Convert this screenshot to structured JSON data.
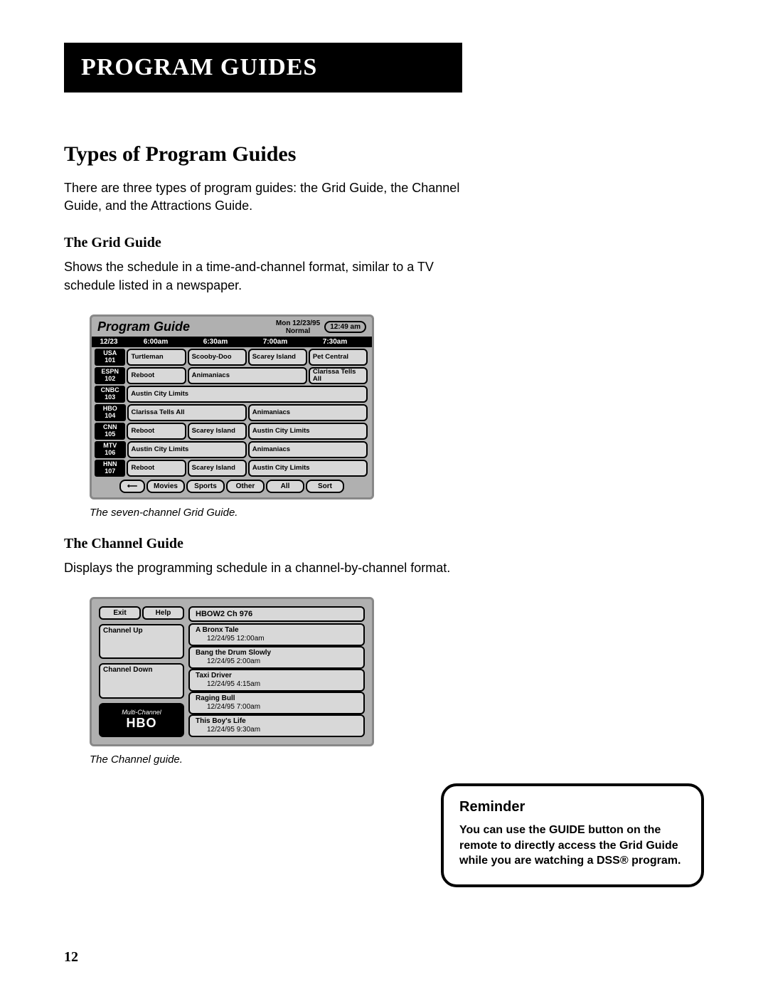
{
  "header": "PROGRAM GUIDES",
  "section_title": "Types of Program Guides",
  "intro": "There are three types of program guides: the Grid Guide, the Channel Guide, and the Attractions Guide.",
  "grid": {
    "heading": "The Grid Guide",
    "desc": "Shows the schedule in a time-and-channel format, similar to a TV schedule listed in a newspaper.",
    "caption": "The seven-channel Grid Guide.",
    "title": "Program Guide",
    "date": "Mon 12/23/95",
    "mode": "Normal",
    "clock": "12:49 am",
    "time_header_date": "12/23",
    "times": [
      "6:00am",
      "6:30am",
      "7:00am",
      "7:30am"
    ],
    "rows": [
      {
        "ch": "USA",
        "num": "101",
        "cells": [
          {
            "w": 1,
            "t": "Turtleman"
          },
          {
            "w": 1,
            "t": "Scooby-Doo"
          },
          {
            "w": 1,
            "t": "Scarey Island"
          },
          {
            "w": 1,
            "t": "Pet Central"
          }
        ]
      },
      {
        "ch": "ESPN",
        "num": "102",
        "cells": [
          {
            "w": 1,
            "t": "Reboot"
          },
          {
            "w": 2,
            "t": "Animaniacs"
          },
          {
            "w": 1,
            "t": "Clarissa Tells All"
          }
        ]
      },
      {
        "ch": "CNBC",
        "num": "103",
        "cells": [
          {
            "w": 4,
            "t": "Austin City Limits"
          }
        ]
      },
      {
        "ch": "HBO",
        "num": "104",
        "cells": [
          {
            "w": 2,
            "t": "Clarissa Tells All"
          },
          {
            "w": 2,
            "t": "Animaniacs"
          }
        ]
      },
      {
        "ch": "CNN",
        "num": "105",
        "cells": [
          {
            "w": 1,
            "t": "Reboot"
          },
          {
            "w": 1,
            "t": "Scarey Island"
          },
          {
            "w": 2,
            "t": "Austin City Limits"
          }
        ]
      },
      {
        "ch": "MTV",
        "num": "106",
        "cells": [
          {
            "w": 2,
            "t": "Austin City Limits"
          },
          {
            "w": 2,
            "t": "Animaniacs"
          }
        ]
      },
      {
        "ch": "HNN",
        "num": "107",
        "cells": [
          {
            "w": 1,
            "t": "Reboot"
          },
          {
            "w": 1,
            "t": "Scarey Island"
          },
          {
            "w": 2,
            "t": "Austin City Limits"
          }
        ]
      }
    ],
    "footer_buttons": [
      "Movies",
      "Sports",
      "Other",
      "All",
      "Sort"
    ]
  },
  "channel": {
    "heading": "The Channel Guide",
    "desc": "Displays the programming schedule in a channel-by-channel format.",
    "caption": "The Channel guide.",
    "left_buttons_top": [
      "Exit",
      "Help"
    ],
    "chan_up": "Channel Up",
    "chan_down": "Channel Down",
    "logo_top": "Multi-Channel",
    "logo_main": "HBO",
    "header": "HBOW2  Ch  976",
    "items": [
      {
        "title": "A Bronx Tale",
        "sub": "12/24/95   12:00am"
      },
      {
        "title": "Bang the Drum Slowly",
        "sub": "12/24/95   2:00am"
      },
      {
        "title": "Taxi Driver",
        "sub": "12/24/95   4:15am"
      },
      {
        "title": "Raging Bull",
        "sub": "12/24/95   7:00am"
      },
      {
        "title": "This Boy's Life",
        "sub": "12/24/95   9:30am"
      }
    ]
  },
  "reminder": {
    "title": "Reminder",
    "text": "You can use the GUIDE button on the remote to directly access the Grid Guide while you are watching a DSS® program."
  },
  "page_number": "12"
}
